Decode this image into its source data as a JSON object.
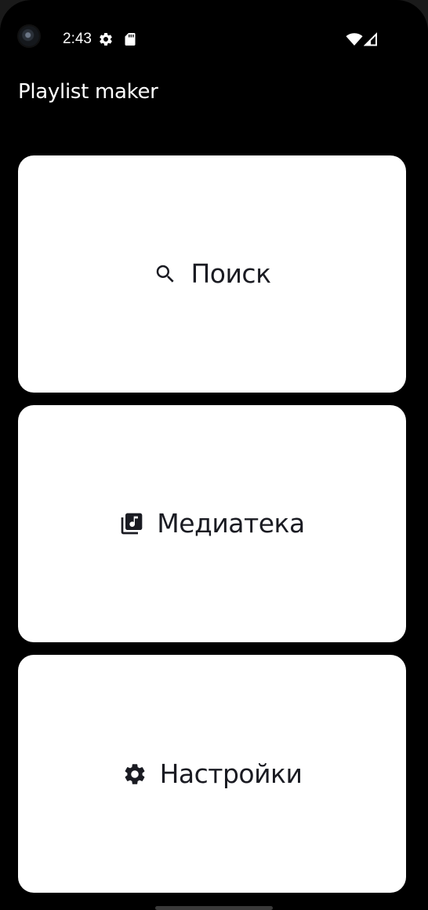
{
  "status_bar": {
    "time": "2:43",
    "icons": [
      "camera-lens-icon",
      "settings-gear-icon",
      "sd-card-icon",
      "wifi-icon",
      "cellular-signal-icon"
    ]
  },
  "app": {
    "title": "Playlist maker"
  },
  "menu": [
    {
      "label": "Поиск",
      "icon": "search-icon"
    },
    {
      "label": "Медиатека",
      "icon": "music-library-icon"
    },
    {
      "label": "Настройки",
      "icon": "settings-icon"
    }
  ],
  "colors": {
    "background": "#000000",
    "card": "#ffffff",
    "card_text": "#1a1b22",
    "title_text": "#ffffff"
  }
}
